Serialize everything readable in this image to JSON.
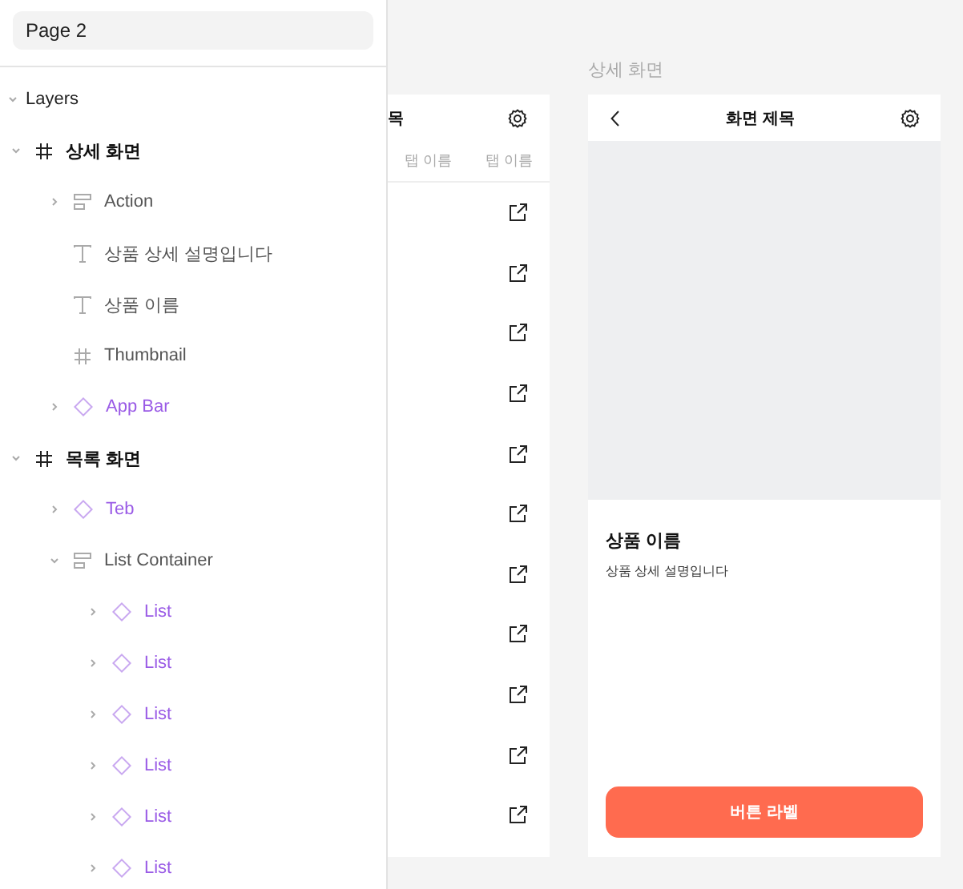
{
  "page_field": {
    "value": "Page 2"
  },
  "layers": {
    "title": "Layers",
    "expanded": true,
    "items": [
      {
        "name": "상세 화면",
        "kind": "frame",
        "expanded": true,
        "children": [
          {
            "name": "Action",
            "kind": "stack",
            "expanded": false
          },
          {
            "name": "상품 상세 설명입니다",
            "kind": "text"
          },
          {
            "name": "상품 이름",
            "kind": "text"
          },
          {
            "name": "Thumbnail",
            "kind": "frame"
          },
          {
            "name": "App Bar",
            "kind": "component",
            "expanded": false
          }
        ]
      },
      {
        "name": "목록 화면",
        "kind": "frame",
        "expanded": true,
        "children": [
          {
            "name": "Teb",
            "kind": "component",
            "expanded": false
          },
          {
            "name": "List Container",
            "kind": "stack",
            "expanded": true,
            "children": [
              {
                "name": "List",
                "kind": "component",
                "expanded": false
              },
              {
                "name": "List",
                "kind": "component",
                "expanded": false
              },
              {
                "name": "List",
                "kind": "component",
                "expanded": false
              },
              {
                "name": "List",
                "kind": "component",
                "expanded": false
              },
              {
                "name": "List",
                "kind": "component",
                "expanded": false
              },
              {
                "name": "List",
                "kind": "component",
                "expanded": false
              }
            ]
          }
        ]
      }
    ]
  },
  "list_screen": {
    "title": "목",
    "tabs": [
      {
        "label": "탭 이름",
        "selected": false
      },
      {
        "label": "탭 이름",
        "selected": false
      }
    ],
    "rows": [
      {
        "kind": "link"
      },
      {
        "kind": "link"
      },
      {
        "kind": "link"
      },
      {
        "kind": "link"
      },
      {
        "kind": "link"
      },
      {
        "kind": "link"
      },
      {
        "kind": "link"
      },
      {
        "kind": "link"
      },
      {
        "kind": "link"
      },
      {
        "kind": "link"
      },
      {
        "kind": "link"
      }
    ]
  },
  "detail_screen": {
    "frame_label": "상세 화면",
    "title": "화면 제목",
    "product_name": "상품 이름",
    "description": "상품 상세 설명입니다",
    "button": "버튼 라벨"
  }
}
